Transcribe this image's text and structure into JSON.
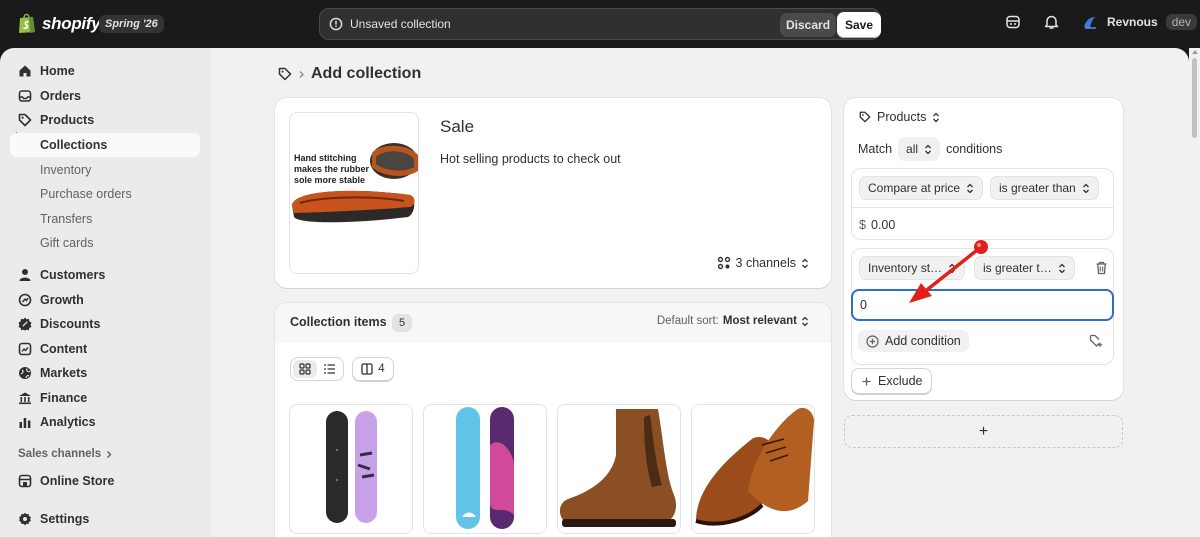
{
  "topbar": {
    "brand": "shopify",
    "edition": "Spring '26",
    "unsaved_message": "Unsaved collection",
    "discard_label": "Discard",
    "save_label": "Save",
    "user_name": "Revnous",
    "store_badge": "dev",
    "icons": [
      "store-icon",
      "bell-icon",
      "avatar"
    ]
  },
  "sidebar": {
    "items": [
      {
        "label": "Home",
        "icon": "home-icon"
      },
      {
        "label": "Orders",
        "icon": "inbox-icon"
      },
      {
        "label": "Products",
        "icon": "tag-icon"
      },
      {
        "label": "Collections",
        "active": true
      },
      {
        "label": "Inventory"
      },
      {
        "label": "Purchase orders"
      },
      {
        "label": "Transfers"
      },
      {
        "label": "Gift cards"
      },
      {
        "label": "Customers",
        "icon": "person-icon"
      },
      {
        "label": "Growth",
        "icon": "growth-icon"
      },
      {
        "label": "Discounts",
        "icon": "discount-icon"
      },
      {
        "label": "Content",
        "icon": "content-icon"
      },
      {
        "label": "Markets",
        "icon": "globe-icon"
      },
      {
        "label": "Finance",
        "icon": "bank-icon"
      },
      {
        "label": "Analytics",
        "icon": "chart-icon"
      }
    ],
    "sales_channels_label": "Sales channels",
    "online_store_label": "Online Store",
    "settings_label": "Settings"
  },
  "page": {
    "title": "Add collection"
  },
  "collection": {
    "thumbnail_text": [
      "Hand stitching",
      "makes the rubber",
      "sole more stable"
    ],
    "title": "Sale",
    "description": "Hot selling products to check out",
    "channels_label": "3 channels"
  },
  "items": {
    "title": "Collection items",
    "count": "5",
    "sort_label": "Default sort:",
    "sort_value": "Most relevant",
    "columns_count": "4",
    "products": [
      "snowboard-purple",
      "snowboard-blue",
      "chelsea-boot",
      "oxford-shoes"
    ]
  },
  "conditions": {
    "header_label": "Products",
    "match_label": "Match",
    "match_value": "all",
    "conditions_label": "conditions",
    "rule1": {
      "field": "Compare at price",
      "operator": "is greater than",
      "currency": "$",
      "value": "0.00"
    },
    "rule2": {
      "field": "Inventory st…",
      "operator": "is greater t…",
      "value": "0"
    },
    "add_condition_label": "Add condition",
    "exclude_label": "Exclude",
    "add_section_symbol": "+"
  },
  "colors": {
    "topbar": "#1a1a1a",
    "focus_blue": "#2c6ecb",
    "annotation_red": "#e0201b"
  }
}
